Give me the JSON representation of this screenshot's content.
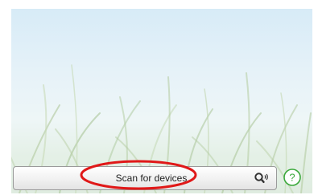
{
  "scan_button": {
    "label": "Scan for devices",
    "icon": "search-sound-icon"
  },
  "help_button": {
    "icon": "help-circle-icon",
    "symbol": "?"
  },
  "background": {
    "description": "sky-and-grass-wallpaper"
  },
  "colors": {
    "help_green": "#3aa83a",
    "highlight_red": "#e01818"
  }
}
